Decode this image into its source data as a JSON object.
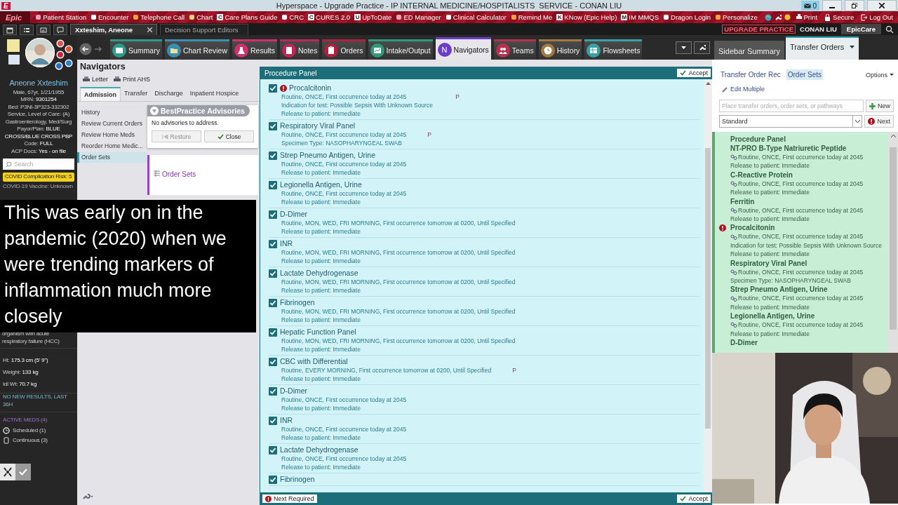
{
  "title_bar": {
    "logo": "E",
    "title": "Hyperspace - Upgrade Practice - IP INTERNAL MEDICINE/HOSPITALISTS  SERVICE - CONAN LIU",
    "mail_count": "0"
  },
  "toolbar": {
    "logo": "Epic",
    "items": [
      {
        "label": "Patient Station"
      },
      {
        "label": "Encounter"
      },
      {
        "label": "Telephone Call"
      },
      {
        "label": "Chart"
      },
      {
        "label": "Care Plans Guide",
        "badge": "C"
      },
      {
        "label": "CRC"
      },
      {
        "label": "CURES 2.0",
        "badge": "C"
      },
      {
        "label": "UpToDate",
        "badge": "U"
      },
      {
        "label": "ED Manager"
      },
      {
        "label": "Clinical Calculator"
      },
      {
        "label": "Remind Me"
      },
      {
        "label": "KNow (Epic Help)",
        "badge": "K"
      },
      {
        "label": "IM MMQS",
        "badge": "M"
      },
      {
        "label": "Dragon Login"
      },
      {
        "label": "Personalize"
      }
    ],
    "right_items": [
      {
        "label": "Print"
      },
      {
        "label": "Secure"
      },
      {
        "label": "Log Out"
      }
    ]
  },
  "workspace_tabs": [
    {
      "label": "Xxteshim, Aneone",
      "selected": true
    },
    {
      "label": "Decision Support Editors",
      "selected": false
    }
  ],
  "environment": {
    "badge": "UPGRADE PRACTICE",
    "user": "CONAN LIU",
    "app": "EpicCare"
  },
  "activity_tabs": [
    {
      "label": "Summary",
      "color": "#2e9a8a",
      "selected": false
    },
    {
      "label": "Chart Review",
      "color": "#3a8fb0",
      "selected": false
    },
    {
      "label": "Results",
      "color": "#d0306a",
      "selected": false
    },
    {
      "label": "Notes",
      "color": "#c0245a",
      "selected": false
    },
    {
      "label": "Orders",
      "color": "#b0203e",
      "selected": false
    },
    {
      "label": "Intake/Output",
      "color": "#2e9a7a",
      "selected": false
    },
    {
      "label": "Navigators",
      "color": "#6a3cc8",
      "selected": true,
      "icon_letter": "N"
    },
    {
      "label": "Teams",
      "color": "#b83050",
      "selected": false
    },
    {
      "label": "History",
      "color": "#a07840",
      "selected": false
    },
    {
      "label": "Flowsheets",
      "color": "#3aa0a8",
      "selected": false
    }
  ],
  "sidebar_tabs": [
    {
      "label": "Sidebar Summary",
      "selected": false
    },
    {
      "label": "Transfer Orders",
      "selected": true
    }
  ],
  "patient": {
    "name": "Aneone Xxteshim",
    "details": [
      "Male, 67yr, 1/21/1955",
      "MRN: **9301254**",
      "Bed: P3NI-3P323-332302",
      "Service, Level of Care: (A) Gastroenterology, Med/Surg",
      "Payor/Plan: **BLUE CROSS/BLUE CROSS PBP**",
      "Code: **FULL**",
      "ACP Docs: **Yes - on file**"
    ],
    "search_placeholder": "Search",
    "covid_risk": "COVID Complication Risk: 5",
    "vaccine": "COVID-19 Vaccine: Unknown",
    "problem": "organism with acute respiratory failure (HCC)",
    "measures": [
      "Ht:  **175.3 cm (5' 9\")**",
      "Weight:  **133 kg**",
      "Idl Wt:  **70.7 kg**"
    ],
    "results": "NO NEW RESULTS, LAST 36H",
    "meds_header": "ACTIVE MEDS (4)",
    "meds": [
      "Scheduled (1)",
      "Continuous (3)"
    ]
  },
  "navigators": {
    "title": "Navigators",
    "actions": [
      "Letter",
      "Print AHS"
    ],
    "tabs": [
      {
        "label": "Admission",
        "selected": true
      },
      {
        "label": "Transfer",
        "selected": false
      },
      {
        "label": "Discharge",
        "selected": false
      },
      {
        "label": "Inpatient Hospice",
        "selected": false
      }
    ],
    "menu": [
      {
        "label": "History",
        "selected": false
      },
      {
        "label": "Review Current Orders",
        "selected": false
      },
      {
        "label": "Review Home Meds",
        "selected": false
      },
      {
        "label": "Reorder Home Medic...",
        "selected": false
      },
      {
        "label": "Order Sets",
        "selected": true
      }
    ],
    "bpa": {
      "title": "BestPractice Advisories",
      "message": "No advisories to address.",
      "buttons": [
        {
          "label": "Restore",
          "disabled": true
        },
        {
          "label": "Close",
          "disabled": false
        }
      ]
    },
    "section": "Order Sets"
  },
  "procedure_panel": {
    "title": "Procedure Panel",
    "accept": "Accept",
    "orders": [
      {
        "name": "Procalcitonin",
        "checked": true,
        "alert": true,
        "flag": "P",
        "details": [
          "Routine, ONCE, First occurrence today at 2045",
          "Indication for test: Possible Sepsis With Unknown Source",
          "Release to patient: Immediate"
        ]
      },
      {
        "name": "Respiratory Viral Panel",
        "checked": true,
        "alert": false,
        "flag": "P",
        "details": [
          "Routine, ONCE, First occurrence today at 2045",
          "Specimen Type: NASOPHARYNGEAL SWAB"
        ]
      },
      {
        "name": "Strep Pneumo Antigen, Urine",
        "checked": true,
        "alert": false,
        "details": [
          "Routine, ONCE, First occurrence today at 2045",
          "Release to patient: Immediate"
        ]
      },
      {
        "name": "Legionella Antigen, Urine",
        "checked": true,
        "alert": false,
        "details": [
          "Routine, ONCE, First occurrence today at 2045",
          "Release to patient: Immediate"
        ]
      },
      {
        "name": "D-Dimer",
        "checked": true,
        "alert": false,
        "details": [
          "Routine, MON, WED, FRI MORNING, First occurrence tomorrow at 0200, Until Specified",
          "Release to patient: Immediate"
        ]
      },
      {
        "name": "INR",
        "checked": true,
        "alert": false,
        "details": [
          "Routine, MON, WED, FRI MORNING, First occurrence tomorrow at 0200, Until Specified",
          "Release to patient: Immediate"
        ]
      },
      {
        "name": "Lactate Dehydrogenase",
        "checked": true,
        "alert": false,
        "details": [
          "Routine, MON, WED, FRI MORNING, First occurrence tomorrow at 0200, Until Specified",
          "Release to patient: Immediate"
        ]
      },
      {
        "name": "Fibrinogen",
        "checked": true,
        "alert": false,
        "details": [
          "Routine, MON, WED, FRI MORNING, First occurrence tomorrow at 0200, Until Specified",
          "Release to patient: Immediate"
        ]
      },
      {
        "name": "Hepatic Function Panel",
        "checked": true,
        "alert": false,
        "details": [
          "Routine, MON, WED, FRI MORNING, First occurrence tomorrow at 0200, Until Specified",
          "Release to patient: Immediate"
        ]
      },
      {
        "name": "CBC with Differential",
        "checked": true,
        "alert": false,
        "flag": "P",
        "details": [
          "Routine, EVERY MORNING, First occurrence tomorrow at 0200, Until Specified",
          "Release to patient: Immediate"
        ]
      },
      {
        "name": "D-Dimer",
        "checked": true,
        "alert": false,
        "details": [
          "Routine, ONCE, First occurrence today at 2045",
          "Release to patient: Immediate"
        ]
      },
      {
        "name": "INR",
        "checked": true,
        "alert": false,
        "details": [
          "Routine, ONCE, First occurrence today at 2045",
          "Release to patient: Immediate"
        ]
      },
      {
        "name": "Lactate Dehydrogenase",
        "checked": true,
        "alert": false,
        "details": [
          "Routine, ONCE, First occurrence today at 2045",
          "Release to patient: Immediate"
        ]
      },
      {
        "name": "Fibrinogen",
        "checked": true,
        "alert": false
      }
    ],
    "footer_note": "Next Required",
    "footer_accept": "Accept"
  },
  "transfer_orders": {
    "links": [
      {
        "label": "Transfer Order Rec",
        "selected": false
      },
      {
        "label": "Order Sets",
        "selected": true
      }
    ],
    "options": "Options",
    "edit": "Edit Multiple",
    "search_placeholder": "Place transfer orders, order sets, or pathways",
    "new": "New",
    "select_value": "Standard",
    "next": "Next",
    "list_title": "Procedure Panel",
    "orders": [
      {
        "name": "NT-PRO B-Type Natriuretic Peptide",
        "alert": false,
        "details": [
          "Routine, ONCE, First occurrence today at 2045",
          "Release to patient: Immediate"
        ]
      },
      {
        "name": "C-Reactive Protein",
        "alert": false,
        "details": [
          "Routine, ONCE, First occurrence today at 2045",
          "Release to patient: Immediate"
        ]
      },
      {
        "name": "Ferritin",
        "alert": false,
        "details": [
          "Routine, ONCE, First occurrence today at 2045",
          "Release to patient: Immediate"
        ]
      },
      {
        "name": "Procalcitonin",
        "alert": true,
        "details": [
          "Routine, ONCE, First occurrence today at 2045",
          "Indication for test: Possible Sepsis With Unknown Source",
          "Release to patient: Immediate"
        ]
      },
      {
        "name": "Respiratory Viral Panel",
        "alert": false,
        "details": [
          "Routine, ONCE, First occurrence today at 2045",
          "Specimen Type: NASOPHARYNGEAL SWAB"
        ]
      },
      {
        "name": "Strep Pneumo Antigen, Urine",
        "alert": false,
        "details": [
          "Routine, ONCE, First occurrence today at 2045",
          "Release to patient: Immediate"
        ]
      },
      {
        "name": "Legionella Antigen, Urine",
        "alert": false,
        "details": [
          "Routine, ONCE, First occurrence today at 2045",
          "Release to patient: Immediate"
        ]
      },
      {
        "name": "D-Dimer",
        "alert": false
      }
    ]
  },
  "caption": "This was early on in the pandemic (2020) when we were trending markers of inflammation much more closely"
}
